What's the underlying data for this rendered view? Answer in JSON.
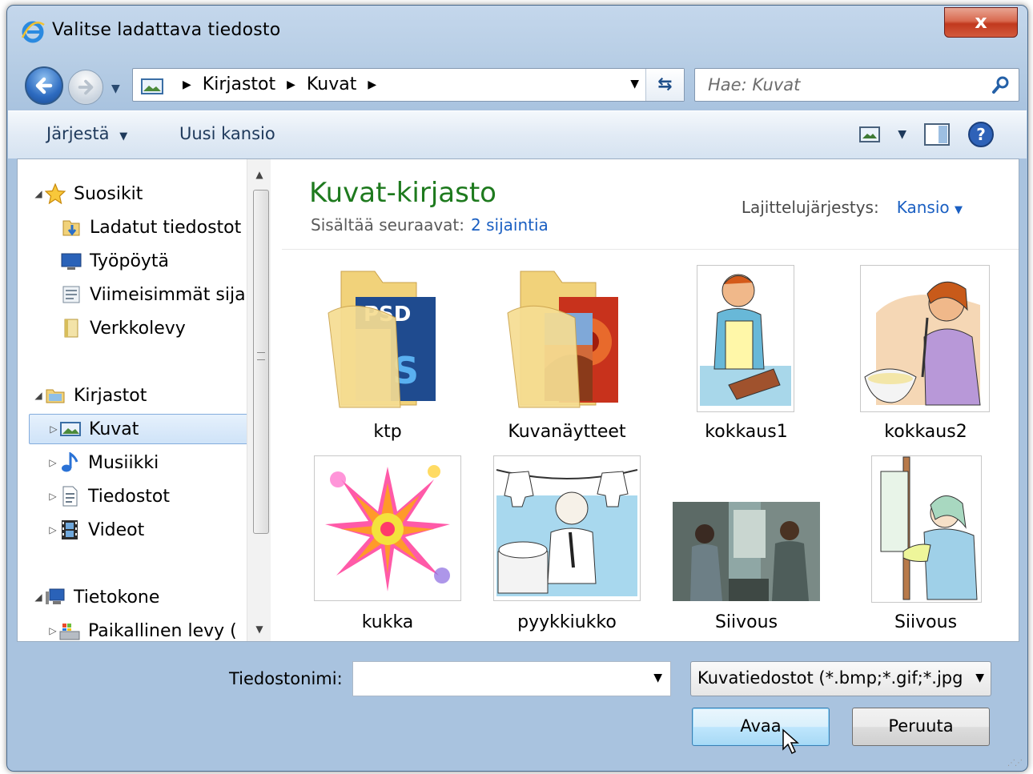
{
  "window": {
    "title": "Valitse ladattava tiedosto",
    "close_label": "x"
  },
  "address": {
    "crumbs": [
      "Kirjastot",
      "Kuvat"
    ],
    "search_placeholder": "Hae: Kuvat"
  },
  "toolbar": {
    "organize_label": "Järjestä",
    "new_folder_label": "Uusi kansio"
  },
  "nav": {
    "favorites": {
      "label": "Suosikit",
      "items": [
        "Ladatut tiedostot",
        "Työpöytä",
        "Viimeisimmät sijainnit",
        "Verkkolevy"
      ]
    },
    "libraries": {
      "label": "Kirjastot",
      "items": [
        "Kuvat",
        "Musiikki",
        "Tiedostot",
        "Videot"
      ]
    },
    "computer": {
      "label": "Tietokone",
      "items": [
        "Paikallinen levy ("
      ]
    }
  },
  "main": {
    "title": "Kuvat-kirjasto",
    "includes_label": "Sisältää seuraavat:",
    "includes_link": "2 sijaintia",
    "sort_label": "Lajittelujärjestys:",
    "sort_value": "Kansio",
    "items": [
      "ktp",
      "Kuvanäytteet",
      "kokkaus1",
      "kokkaus2",
      "kukka",
      "pyykkiukko",
      "Siivous",
      "Siivous"
    ]
  },
  "footer": {
    "filename_label": "Tiedostonimi:",
    "filename_value": "",
    "filter_value": "Kuvatiedostot (*.bmp;*.gif;*.jpg",
    "open_label": "Avaa",
    "cancel_label": "Peruuta"
  },
  "colors": {
    "library_title": "#1e7a1e",
    "link": "#1a5fc2"
  }
}
